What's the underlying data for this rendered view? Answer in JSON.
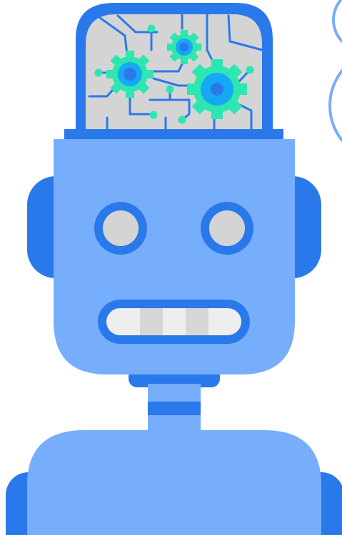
{
  "colors": {
    "background": "#ffffff",
    "body_light_blue": "#76aefc",
    "accent_blue": "#2a79ea",
    "brain_gray": "#d4d4d4",
    "eye_gray": "#d4d4d4",
    "gear_green": "#2ee6b0",
    "gear_center_blue": "#17a8f5",
    "teeth_white": "#eeeeee",
    "teeth_gray": "#d6d6d6",
    "bubble_outline": "#7aaef5"
  },
  "icons": {
    "character": "robot-illustration",
    "brain": "circuit-brain-icon",
    "gears": "gear-icon"
  }
}
